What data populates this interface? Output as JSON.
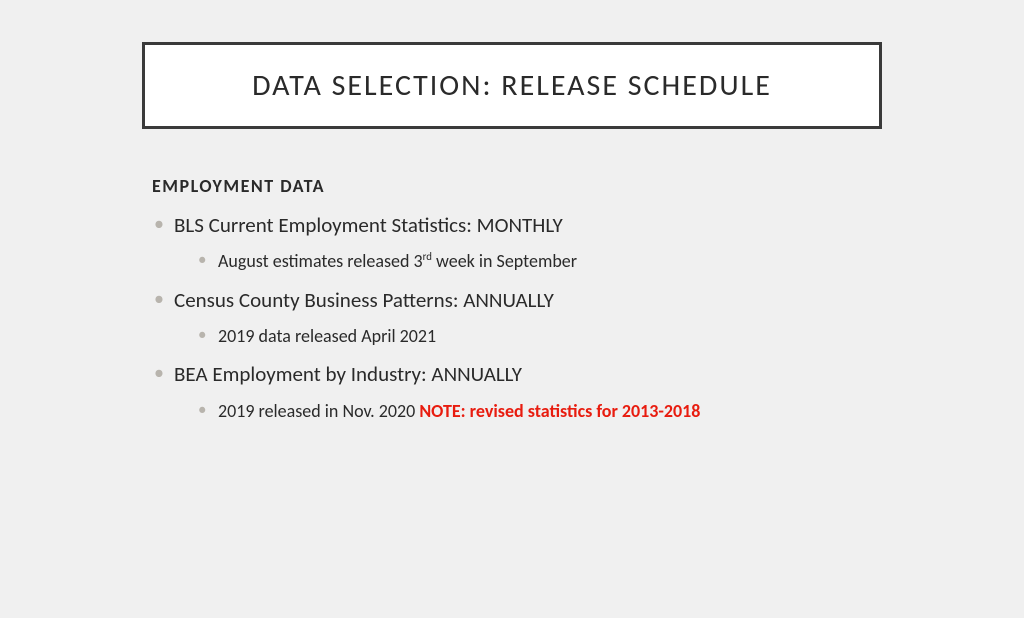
{
  "title": "DATA SELECTION:  RELEASE SCHEDULE",
  "section_heading": "EMPLOYMENT DATA",
  "items": [
    {
      "label": "BLS Current Employment Statistics:  MONTHLY",
      "sub_pre": "August estimates released 3",
      "sub_sup": "rd",
      "sub_post": " week in September",
      "note": ""
    },
    {
      "label": "Census County Business Patterns:  ANNUALLY",
      "sub_pre": "2019 data released April 2021",
      "sub_sup": "",
      "sub_post": "",
      "note": ""
    },
    {
      "label": "BEA Employment by Industry:  ANNUALLY",
      "sub_pre": "2019 released in Nov. 2020 ",
      "sub_sup": "",
      "sub_post": "",
      "note": "NOTE:  revised statistics for 2013-2018"
    }
  ]
}
